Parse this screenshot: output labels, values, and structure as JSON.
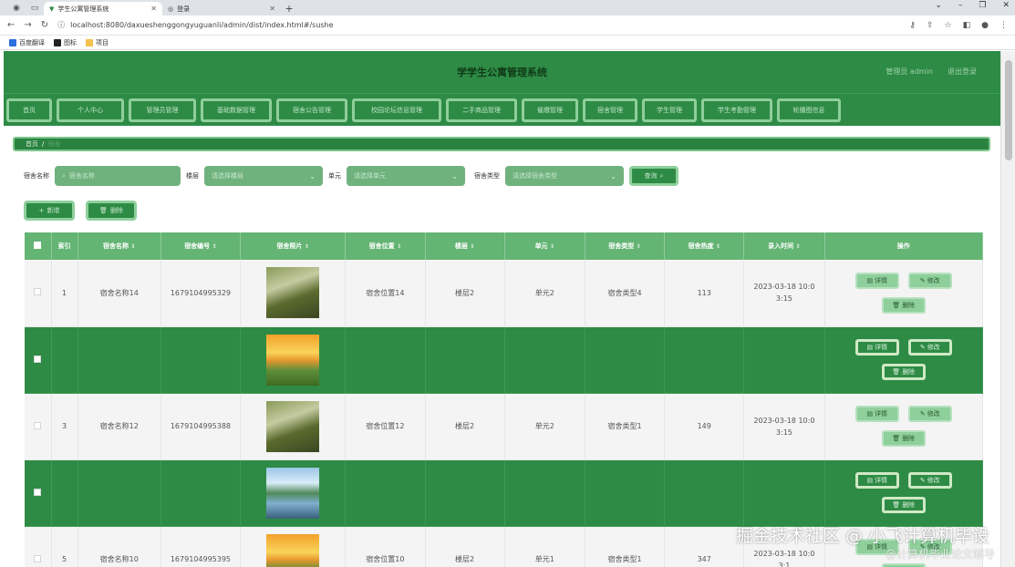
{
  "browser": {
    "tabs": [
      {
        "title": "学生公寓管理系统",
        "active": true
      },
      {
        "title": "登录",
        "active": false
      }
    ],
    "url": "localhost:8080/daxueshenggongyuguanli/admin/dist/index.html#/sushe",
    "bookmarks": [
      "百度翻译",
      "图标",
      "项目"
    ]
  },
  "header": {
    "title": "学学生公寓管理系统",
    "user": "管理员 admin",
    "logout": "退出登录"
  },
  "menu": [
    "首页",
    "个人中心",
    "管理员管理",
    "基础数据管理",
    "宿舍公告管理",
    "校园论坛信息管理",
    "二手商品管理",
    "催缴管理",
    "宿舍管理",
    "学生管理",
    "学生考勤管理",
    "轮播图信息"
  ],
  "breadcrumb": {
    "home": "首页",
    "current": "宿舍"
  },
  "filters": {
    "dorm_name_label": "宿舍名称",
    "dorm_name_placeholder": "宿舍名称",
    "floor_label": "楼层",
    "floor_placeholder": "请选择楼层",
    "unit_label": "单元",
    "unit_placeholder": "请选择单元",
    "type_label": "宿舍类型",
    "type_placeholder": "请选择宿舍类型",
    "search_label": "查询"
  },
  "actions": {
    "add": "新增",
    "delete": "删除"
  },
  "table": {
    "columns": [
      "索引",
      "宿舍名称",
      "宿舍编号",
      "宿舍照片",
      "宿舍位置",
      "楼层",
      "单元",
      "宿舍类型",
      "宿舍热度",
      "录入时间",
      "操作"
    ],
    "rows": [
      {
        "index": "1",
        "name": "宿舍名称14",
        "code": "1679104995329",
        "photo": "forest",
        "location": "宿舍位置14",
        "floor": "楼层2",
        "unit": "单元2",
        "type": "宿舍类型4",
        "heat": "113",
        "time": "2023-03-18 10:03:15",
        "style": "light"
      },
      {
        "index": "",
        "name": "",
        "code": "",
        "photo": "sunset",
        "location": "",
        "floor": "",
        "unit": "",
        "type": "",
        "heat": "",
        "time": "",
        "style": "dark"
      },
      {
        "index": "3",
        "name": "宿舍名称12",
        "code": "1679104995388",
        "photo": "forest",
        "location": "宿舍位置12",
        "floor": "楼层2",
        "unit": "单元2",
        "type": "宿舍类型1",
        "heat": "149",
        "time": "2023-03-18 10:03:15",
        "style": "light"
      },
      {
        "index": "",
        "name": "",
        "code": "",
        "photo": "lake",
        "location": "",
        "floor": "",
        "unit": "",
        "type": "",
        "heat": "",
        "time": "",
        "style": "dark"
      },
      {
        "index": "5",
        "name": "宿舍名称10",
        "code": "1679104995395",
        "photo": "sunset",
        "location": "宿舍位置10",
        "floor": "楼层2",
        "unit": "单元1",
        "type": "宿舍类型1",
        "heat": "347",
        "time": "2023-03-18 10:03:1",
        "style": "light"
      }
    ],
    "ops": {
      "detail": "详情",
      "edit": "修改",
      "delete": "删除"
    }
  },
  "watermark": {
    "line1": "掘金技术社区 @ 小飞计算机毕设",
    "line2": "@计算机毕业论文辅导"
  }
}
